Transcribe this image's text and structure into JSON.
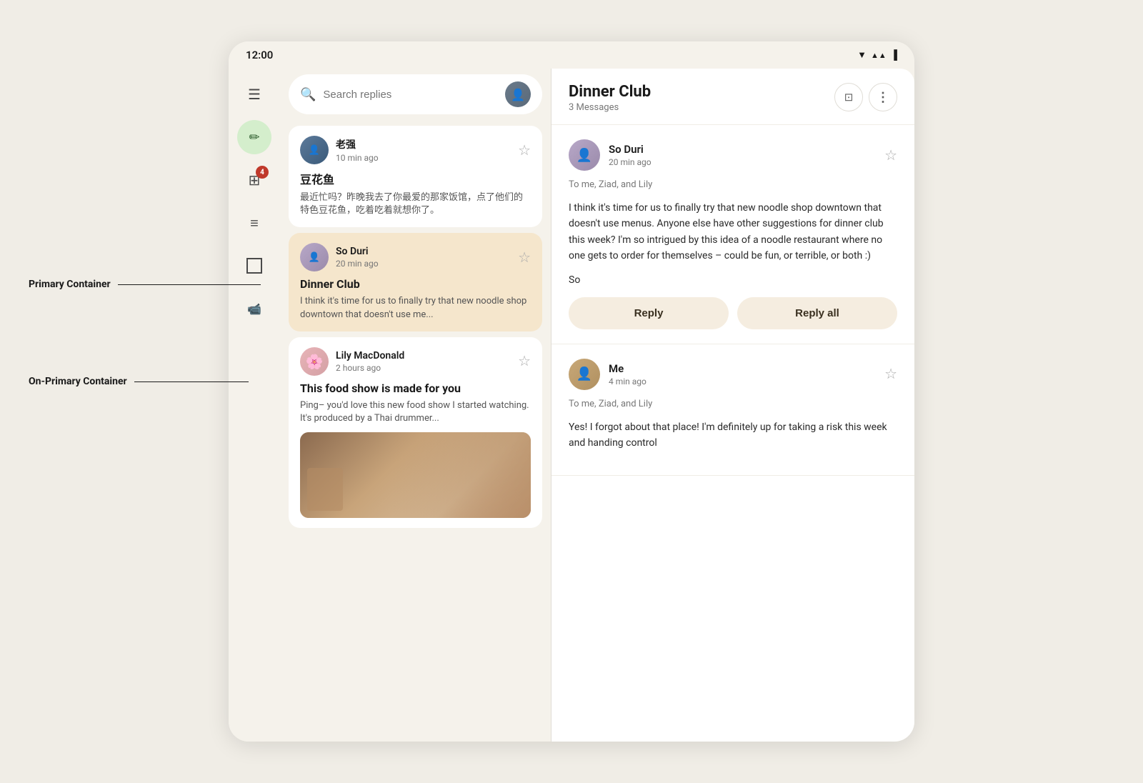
{
  "status_bar": {
    "time": "12:00",
    "icons": [
      "wifi",
      "signal",
      "battery"
    ]
  },
  "sidebar": {
    "icons": [
      {
        "name": "menu-icon",
        "symbol": "☰",
        "label": "Menu",
        "interactable": true
      },
      {
        "name": "compose-icon",
        "symbol": "✎",
        "label": "Compose",
        "interactable": true,
        "style": "compose"
      },
      {
        "name": "notifications-icon",
        "symbol": "🖼",
        "label": "Notifications",
        "interactable": true,
        "badge": "4"
      },
      {
        "name": "notes-icon",
        "symbol": "☰",
        "label": "Notes",
        "interactable": true
      },
      {
        "name": "chat-icon",
        "symbol": "□",
        "label": "Chat",
        "interactable": true
      },
      {
        "name": "video-icon",
        "symbol": "▶",
        "label": "Video",
        "interactable": true
      }
    ]
  },
  "search": {
    "placeholder": "Search replies"
  },
  "email_list": {
    "emails": [
      {
        "id": "email-1",
        "sender": "老强",
        "time": "10 min ago",
        "subject": "豆花鱼",
        "preview": "最近忙吗？昨晚我去了你最爱的那家饭馆，点了他们的特色豆花鱼，吃着吃着就想你了。",
        "avatar_style": "laoquiang",
        "selected": false
      },
      {
        "id": "email-2",
        "sender": "So Duri",
        "time": "20 min ago",
        "subject": "Dinner Club",
        "preview": "I think it's time for us to finally try that new noodle shop downtown that doesn't use me...",
        "avatar_style": "soduri",
        "selected": true
      },
      {
        "id": "email-3",
        "sender": "Lily MacDonald",
        "time": "2 hours ago",
        "subject": "This food show is made for you",
        "preview": "Ping– you'd love this new food show I started watching. It's produced by a Thai drummer...",
        "avatar_style": "lily",
        "selected": false,
        "has_image": true
      }
    ]
  },
  "detail_panel": {
    "title": "Dinner Club",
    "message_count": "3 Messages",
    "messages": [
      {
        "id": "msg-1",
        "sender": "So Duri",
        "time": "20 min ago",
        "recipients": "To me, Ziad, and Lily",
        "body": "I think it's time for us to finally try that new noodle shop downtown that doesn't use menus. Anyone else have other suggestions for dinner club this week? I'm so intrigued by this idea of a noodle restaurant where no one gets to order for themselves – could be fun, or terrible, or both :)",
        "signature": "So",
        "avatar_style": "soduri",
        "show_reply": true
      },
      {
        "id": "msg-2",
        "sender": "Me",
        "time": "4 min ago",
        "recipients": "To me, Ziad, and Lily",
        "body": "Yes! I forgot about that place! I'm definitely up for taking a risk this week and handing control",
        "avatar_style": "me",
        "show_reply": false
      }
    ],
    "reply_button": "Reply",
    "reply_all_button": "Reply all"
  },
  "annotations": {
    "primary_container_label": "Primary Container",
    "on_primary_container_label": "On-Primary Container"
  }
}
